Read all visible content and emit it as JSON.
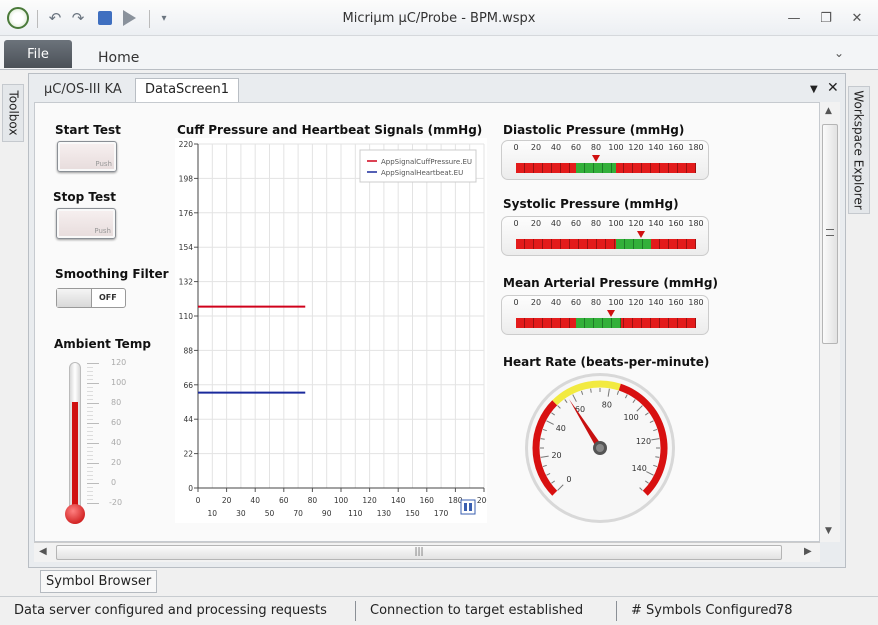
{
  "window": {
    "title": "Micriμm μC/Probe - BPM.wspx",
    "minimize": "—",
    "restore": "❐",
    "close": "✕"
  },
  "ribbon": {
    "file_tab": "File",
    "home_tab": "Home"
  },
  "side_panels": {
    "toolbox": "Toolbox",
    "workspace_explorer": "Workspace Explorer"
  },
  "document_tabs": [
    "μC/OS-III KA",
    "DataScreen1"
  ],
  "controls": {
    "start_test_label": "Start Test",
    "stop_test_label": "Stop Test",
    "push_label": "Push",
    "smoothing_filter_label": "Smoothing Filter",
    "smoothing_state": "OFF",
    "ambient_temp_label": "Ambient Temp",
    "thermometer_ticks": [
      "120",
      "100",
      "80",
      "60",
      "40",
      "20",
      "0",
      "-20"
    ],
    "thermometer_level_pct": 75
  },
  "chart_data": {
    "type": "line",
    "title": "Cuff Pressure and Heartbeat Signals (mmHg)",
    "xlim": [
      0,
      200
    ],
    "ylim": [
      0,
      220
    ],
    "x_ticks_top": [
      "0",
      "20",
      "40",
      "60",
      "80",
      "100",
      "120",
      "140",
      "160",
      "180",
      "200"
    ],
    "x_ticks_bottom": [
      "10",
      "30",
      "50",
      "70",
      "90",
      "110",
      "130",
      "150",
      "170"
    ],
    "y_ticks": [
      "220",
      "198",
      "176",
      "154",
      "132",
      "110",
      "88",
      "66",
      "44",
      "22",
      "0"
    ],
    "grid": true,
    "legend_position": "top-right",
    "series": [
      {
        "name": "AppSignalCuffPressure.EU",
        "color": "#d0021b",
        "x": [
          0,
          75
        ],
        "y": [
          116,
          116
        ]
      },
      {
        "name": "AppSignalHeartbeat.EU",
        "color": "#1a2a9c",
        "x": [
          0,
          75
        ],
        "y": [
          61,
          61
        ]
      }
    ]
  },
  "gauges": {
    "scale": [
      "0",
      "20",
      "40",
      "60",
      "80",
      "100",
      "120",
      "140",
      "160",
      "180"
    ],
    "diastolic": {
      "label": "Diastolic Pressure (mmHg)",
      "value": 80,
      "green_from": 60,
      "green_to": 100
    },
    "systolic": {
      "label": "Systolic Pressure (mmHg)",
      "value": 125,
      "green_from": 100,
      "green_to": 135
    },
    "mean_arterial": {
      "label": "Mean Arterial Pressure (mmHg)",
      "value": 95,
      "green_from": 60,
      "green_to": 105
    }
  },
  "heart_rate": {
    "label": "Heart Rate (beats-per-minute)",
    "ticks": [
      "0",
      "20",
      "40",
      "60",
      "80",
      "100",
      "120",
      "140"
    ],
    "min": 0,
    "max": 150,
    "value": 57
  },
  "bottom": {
    "symbol_browser_tab": "Symbol Browser",
    "scroll_grip": "|||"
  },
  "status": {
    "server": "Data server configured and processing requests",
    "connection": "Connection to target established",
    "symbols_label": "# Symbols Configured:",
    "symbols_count": "78"
  }
}
